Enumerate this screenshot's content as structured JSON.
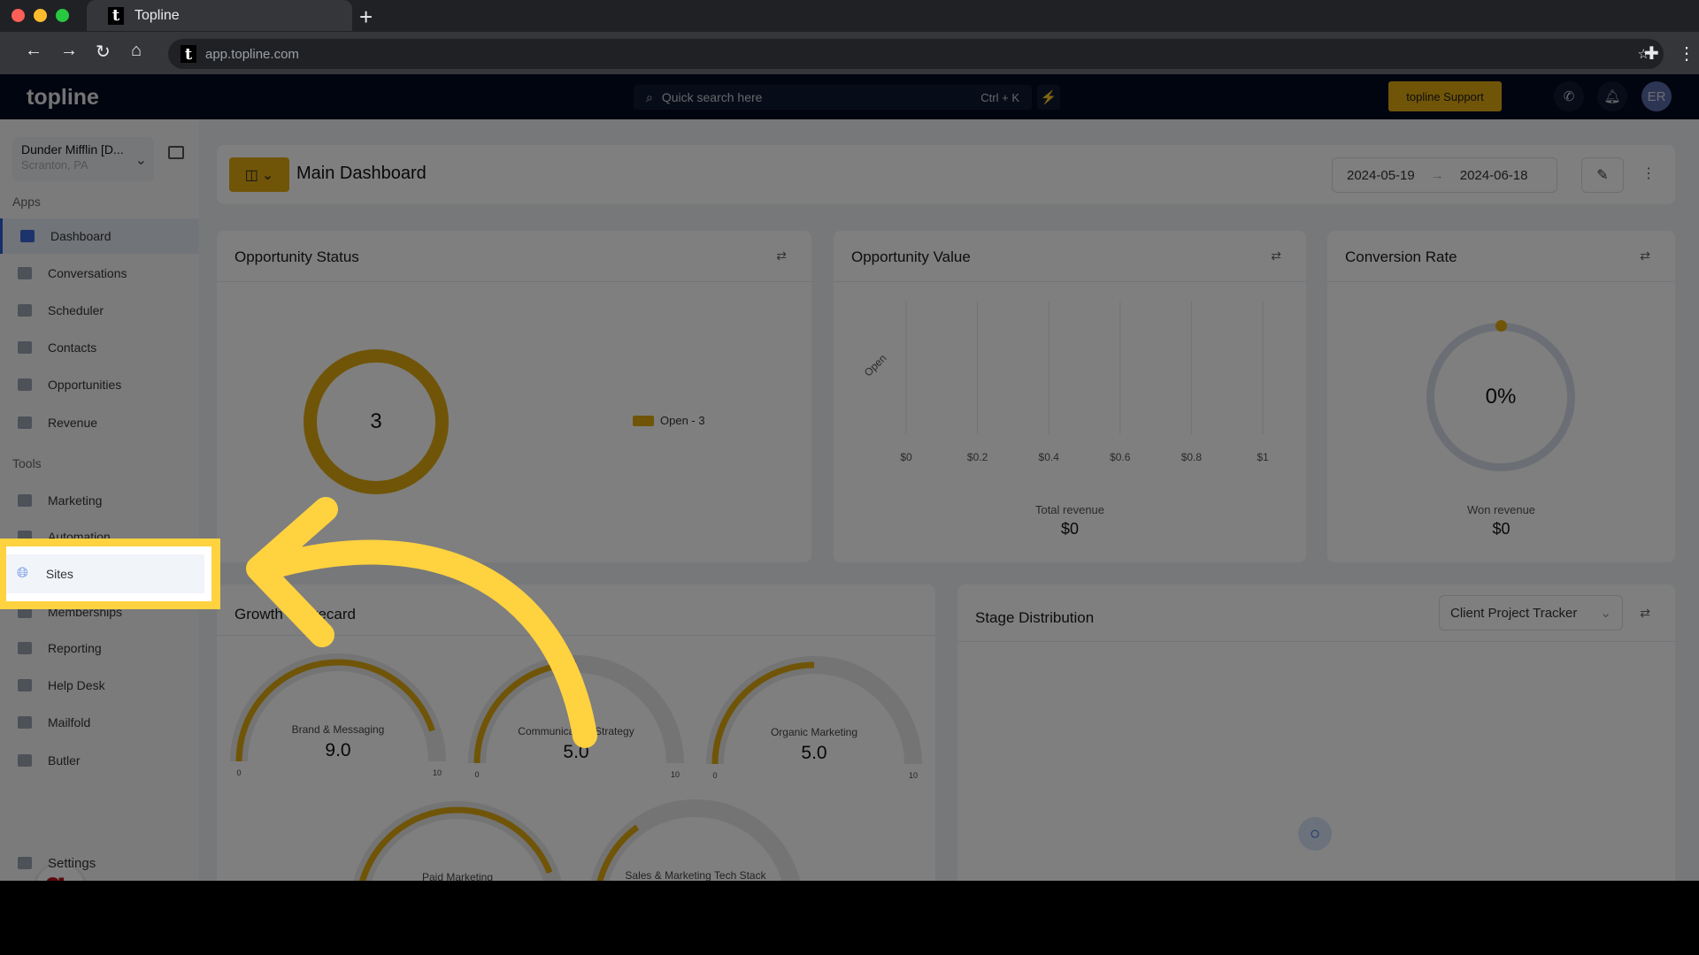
{
  "browser": {
    "tab_title": "Topline",
    "favicon": "t",
    "url": "app.topline.com"
  },
  "header": {
    "logo": "topline",
    "search_placeholder": "Quick search here",
    "search_shortcut": "Ctrl + K",
    "support_label": "topline Support",
    "avatar_initials": "ER"
  },
  "account": {
    "name": "Dunder Mifflin [D...",
    "location": "Scranton, PA"
  },
  "sidebar": {
    "apps_label": "Apps",
    "apps": [
      {
        "label": "Dashboard",
        "icon": "dashboard-icon",
        "active": true
      },
      {
        "label": "Conversations",
        "icon": "chat-icon"
      },
      {
        "label": "Scheduler",
        "icon": "calendar-icon"
      },
      {
        "label": "Contacts",
        "icon": "person-icon"
      },
      {
        "label": "Opportunities",
        "icon": "target-icon"
      },
      {
        "label": "Revenue",
        "icon": "card-icon"
      }
    ],
    "tools_label": "Tools",
    "tools": [
      {
        "label": "Marketing",
        "icon": "megaphone-icon"
      },
      {
        "label": "Automation",
        "icon": "gear-icon"
      },
      {
        "label": "Sites",
        "icon": "globe-icon",
        "highlighted": true
      },
      {
        "label": "Memberships",
        "icon": "users-icon"
      },
      {
        "label": "Reporting",
        "icon": "pie-icon"
      },
      {
        "label": "Help Desk",
        "icon": "help-icon"
      },
      {
        "label": "Mailfold",
        "icon": "mail-icon"
      },
      {
        "label": "Butler",
        "icon": "bell-icon"
      }
    ],
    "settings_label": "Settings"
  },
  "dashboard": {
    "title": "Main Dashboard",
    "date_start": "2024-05-19",
    "date_end": "2024-06-18"
  },
  "opportunity_status": {
    "title": "Opportunity Status",
    "total": "3",
    "legend": "Open - 3"
  },
  "opportunity_value": {
    "title": "Opportunity Value",
    "footer_label": "Total revenue",
    "footer_value": "$0",
    "chart_data": {
      "type": "bar",
      "categories": [
        "Open"
      ],
      "values": [
        0
      ],
      "xticks": [
        "$0",
        "$0.2",
        "$0.4",
        "$0.6",
        "$0.8",
        "$1"
      ],
      "xlim": [
        0,
        1
      ],
      "grid": true
    }
  },
  "conversion_rate": {
    "title": "Conversion Rate",
    "value": "0%",
    "footer_label": "Won revenue",
    "footer_value": "$0"
  },
  "growth_scorecard": {
    "title": "Growth Scorecard",
    "min": "0",
    "max": "10",
    "gauges": [
      {
        "label": "Brand & Messaging",
        "value": 9.0,
        "text": "9.0"
      },
      {
        "label": "Communication Strategy",
        "value": 5.0,
        "text": "5.0"
      },
      {
        "label": "Organic Marketing",
        "value": 5.0,
        "text": "5.0"
      },
      {
        "label": "Paid Marketing",
        "value": 8.8
      },
      {
        "label": "Sales & Marketing Tech Stack",
        "value": 3.0
      }
    ]
  },
  "stage_distribution": {
    "title": "Stage Distribution",
    "pipeline": "Client Project Tracker"
  },
  "colors": {
    "accent": "#e0aa10",
    "highlight": "#ffd23f",
    "nav": "#020b20"
  }
}
